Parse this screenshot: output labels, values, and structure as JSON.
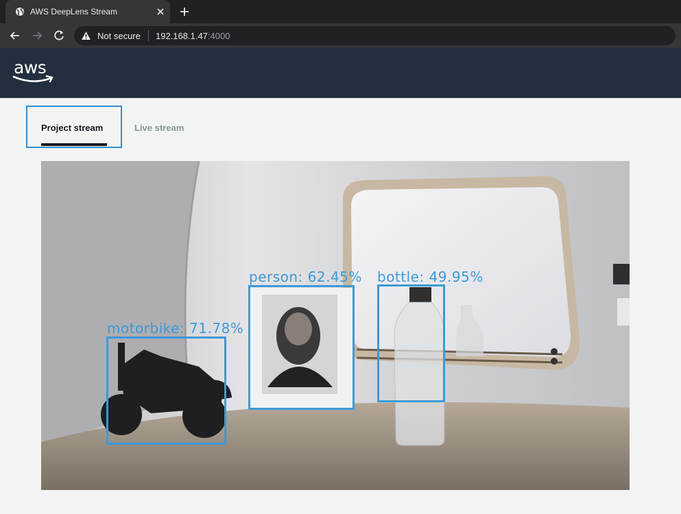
{
  "browser": {
    "tab_title": "AWS DeepLens Stream",
    "security_label": "Not secure",
    "url_host": "192.168.1.47",
    "url_port": ":4000"
  },
  "tabs": {
    "project_label": "Project stream",
    "live_label": "Live stream",
    "active": "Project stream"
  },
  "detections": [
    {
      "label": "motorbike: 71.78%"
    },
    {
      "label": "person: 62.45%"
    },
    {
      "label": "bottle: 49.95%"
    }
  ],
  "colors": {
    "detection": "#3b9ad9",
    "aws_header": "#232f3e",
    "tab_active_border": "#2e8fd2"
  },
  "icons": {
    "tab_favicon": "globe-icon",
    "close": "close-icon",
    "new_tab": "plus-icon",
    "back": "back-arrow-icon",
    "forward": "forward-arrow-icon",
    "reload": "reload-icon",
    "security": "warning-icon"
  }
}
